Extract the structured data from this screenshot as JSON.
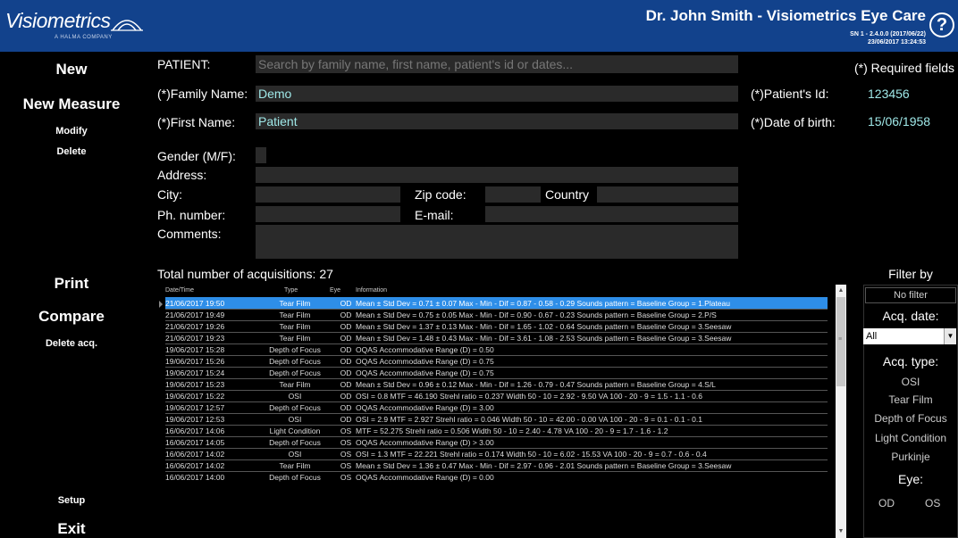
{
  "header": {
    "logo_text": "Visiometrics",
    "logo_tagline": "A HALMA COMPANY",
    "title": "Dr. John Smith  - Visiometrics Eye Care",
    "version_line1": "SN 1 - 2.4.0.0 (2017/06/22)",
    "version_line2": "23/06/2017 13:24:53",
    "help_label": "?"
  },
  "left_menu": {
    "new": "New",
    "new_measure": "New Measure",
    "modify": "Modify",
    "delete": "Delete",
    "print": "Print",
    "compare": "Compare",
    "delete_acq": "Delete acq.",
    "setup": "Setup",
    "exit": "Exit"
  },
  "form": {
    "patient_label": "PATIENT:",
    "search_placeholder": "Search by family name, first name, patient's id or dates...",
    "required_note": "(*) Required fields",
    "family_name_label": "(*)Family Name:",
    "family_name": "Demo",
    "patient_id_label": "(*)Patient's Id:",
    "patient_id": "123456",
    "first_name_label": "(*)First Name:",
    "first_name": "Patient",
    "dob_label": "(*)Date of birth:",
    "dob": "15/06/1958",
    "gender_label": "Gender (M/F):",
    "address_label": "Address:",
    "city_label": "City:",
    "zip_label": "Zip code:",
    "country_label": "Country",
    "phone_label": "Ph. number:",
    "email_label": "E-mail:",
    "comments_label": "Comments:"
  },
  "acquisitions": {
    "total_label": "Total number of acquisitions: 27",
    "columns": [
      "Date/Time",
      "Type",
      "Eye",
      "Information"
    ],
    "rows": [
      [
        "21/06/2017 19:50",
        "Tear Film",
        "OD",
        "Mean ± Std Dev = 0.71 ± 0.07  Max - Min - Dif = 0.87 - 0.58 - 0.29  Sounds pattern = Baseline  Group = 1.Plateau"
      ],
      [
        "21/06/2017 19:49",
        "Tear Film",
        "OD",
        "Mean ± Std Dev = 0.75 ± 0.05  Max - Min - Dif = 0.90 - 0.67 - 0.23  Sounds pattern = Baseline  Group = 2.P/S"
      ],
      [
        "21/06/2017 19:26",
        "Tear Film",
        "OD",
        "Mean ± Std Dev = 1.37 ± 0.13  Max - Min - Dif = 1.65 - 1.02 - 0.64  Sounds pattern = Baseline  Group = 3.Seesaw"
      ],
      [
        "21/06/2017 19:23",
        "Tear Film",
        "OD",
        "Mean ± Std Dev = 1.48 ± 0.43  Max - Min - Dif = 3.61 - 1.08 - 2.53  Sounds pattern = Baseline  Group = 3.Seesaw"
      ],
      [
        "19/06/2017 15:28",
        "Depth of Focus",
        "OD",
        "OQAS Accommodative Range (D) = 0.50"
      ],
      [
        "19/06/2017 15:26",
        "Depth of Focus",
        "OD",
        "OQAS Accommodative Range (D) = 0.75"
      ],
      [
        "19/06/2017 15:24",
        "Depth of Focus",
        "OD",
        "OQAS Accommodative Range (D) = 0.75"
      ],
      [
        "19/06/2017 15:23",
        "Tear Film",
        "OD",
        "Mean ± Std Dev = 0.96 ± 0.12  Max - Min - Dif = 1.26 - 0.79 - 0.47  Sounds pattern = Baseline  Group = 4.S/L"
      ],
      [
        "19/06/2017 15:22",
        "OSI",
        "OD",
        "OSI = 0.8  MTF = 46.190  Strehl ratio = 0.237  Width 50 - 10 = 2.92 - 9.50  VA 100 - 20 - 9 = 1.5 - 1.1 - 0.6"
      ],
      [
        "19/06/2017 12:57",
        "Depth of Focus",
        "OD",
        "OQAS Accommodative Range (D) = 3.00"
      ],
      [
        "19/06/2017 12:53",
        "OSI",
        "OD",
        "OSI = 2.9  MTF = 2.927  Strehl ratio = 0.046  Width 50 - 10 = 42.00 - 0.00  VA 100 - 20 - 9 = 0.1 - 0.1 - 0.1"
      ],
      [
        "16/06/2017 14:06",
        "Light Condition",
        "OS",
        "MTF = 52.275  Strehl ratio = 0.506  Width 50 - 10 = 2.40 - 4.78  VA 100 - 20 - 9 = 1.7 - 1.6 - 1.2"
      ],
      [
        "16/06/2017 14:05",
        "Depth of Focus",
        "OS",
        "OQAS Accommodative Range (D) > 3.00"
      ],
      [
        "16/06/2017 14:02",
        "OSI",
        "OS",
        "OSI = 1.3  MTF = 22.221  Strehl ratio = 0.174  Width 50 - 10 = 6.02 - 15.53  VA 100 - 20 - 9 = 0.7 - 0.6 - 0.4"
      ],
      [
        "16/06/2017 14:02",
        "Tear Film",
        "OS",
        "Mean ± Std Dev = 1.36 ± 0.47  Max - Min - Dif = 2.97 - 0.96 - 2.01  Sounds pattern = Baseline  Group = 3.Seesaw"
      ],
      [
        "16/06/2017 14:00",
        "Depth of Focus",
        "OS",
        "OQAS Accommodative Range (D) = 0.00"
      ]
    ]
  },
  "filter": {
    "title": "Filter by",
    "no_filter": "No filter",
    "acq_date_label": "Acq. date:",
    "acq_date_value": "All",
    "acq_type_label": "Acq. type:",
    "types": [
      "OSI",
      "Tear Film",
      "Depth of Focus",
      "Light Condition",
      "Purkinje"
    ],
    "eye_label": "Eye:",
    "eye_od": "OD",
    "eye_os": "OS"
  },
  "colors": {
    "header_bg": "#12428c",
    "selected_row": "#2e8ee8",
    "field_bg": "#2a2a2a"
  }
}
